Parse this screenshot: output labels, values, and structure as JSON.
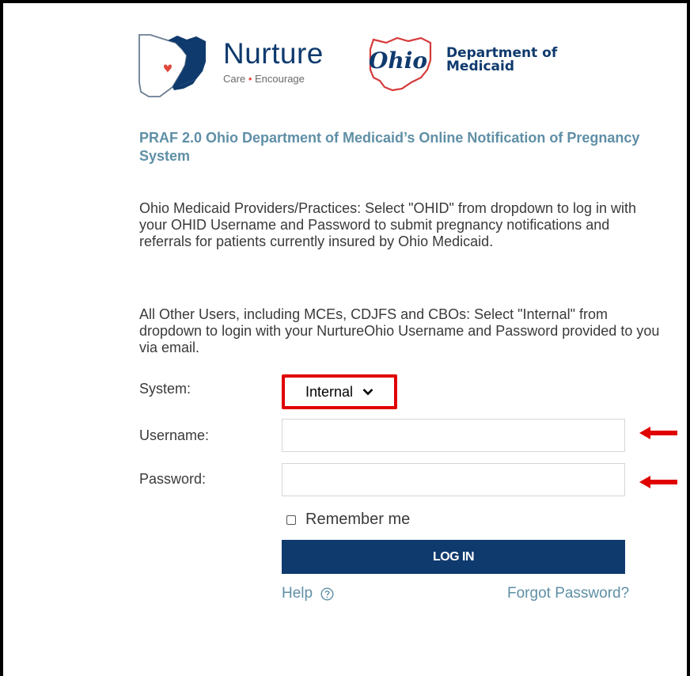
{
  "logo": {
    "brand_word": "Nurture",
    "tagline_left": "Care",
    "tagline_sep": "•",
    "tagline_right": "Encourage",
    "state_script": "Ohio",
    "department_line1": "Department of",
    "department_line2": "Medicaid",
    "icon": "ohio-map-heart-icon"
  },
  "heading": "PRAF 2.0 Ohio Department of Medicaid’s Online Notification of Pregnancy System",
  "intro": {
    "providers_text": "Ohio Medicaid Providers/Practices: Select \"OHID\" from dropdown to log in with your OHID Username and Password to submit pregnancy notifications and referrals for patients currently insured by Ohio Medicaid.",
    "others_text": "All Other Users, including MCEs, CDJFS and CBOs: Select \"Internal\" from dropdown to login with your NurtureOhio Username and Password provided to you via email."
  },
  "form": {
    "system_label": "System:",
    "system_value": "Internal",
    "username_label": "Username:",
    "username_value": "",
    "password_label": "Password:",
    "password_value": "",
    "remember_label": "Remember me",
    "remember_checked": false,
    "login_label": "LOG IN",
    "help_label": "Help",
    "forgot_label": "Forgot Password?"
  },
  "colors": {
    "brand_navy": "#0f3a6e",
    "heading_teal": "#5f8fa6",
    "highlight_red": "#e00000",
    "heart_red": "#e0483b"
  }
}
